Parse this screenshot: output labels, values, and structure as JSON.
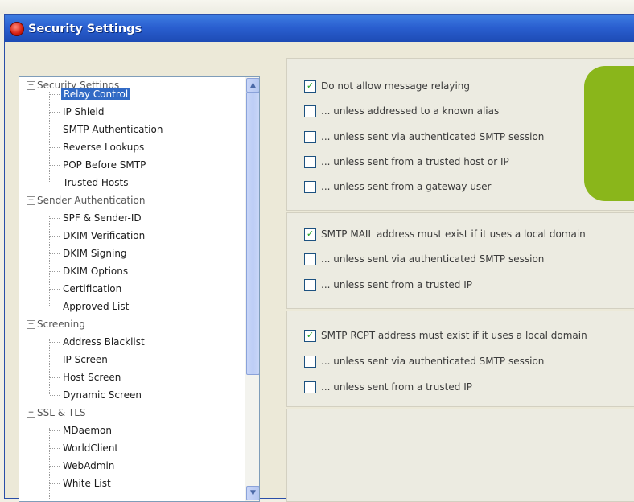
{
  "window": {
    "title": "Security Settings"
  },
  "icons": {
    "app": "app-icon",
    "expand": "expand-icon",
    "collapse": "collapse-icon",
    "scroll_up": "arrow-up-icon",
    "scroll_down": "arrow-down-icon"
  },
  "colors": {
    "titlebar": "#2a5fd0",
    "selection": "#316ac5",
    "accent_tab": "#8ab61b"
  },
  "tree": {
    "items": [
      {
        "label": "Security Settings",
        "level": 0,
        "expanded": true
      },
      {
        "label": "Relay Control",
        "level": 1,
        "selected": true
      },
      {
        "label": "IP Shield",
        "level": 1
      },
      {
        "label": "SMTP Authentication",
        "level": 1
      },
      {
        "label": "Reverse Lookups",
        "level": 1
      },
      {
        "label": "POP Before SMTP",
        "level": 1
      },
      {
        "label": "Trusted Hosts",
        "level": 1
      },
      {
        "label": "Sender Authentication",
        "level": 0,
        "expanded": true
      },
      {
        "label": "SPF & Sender-ID",
        "level": 1
      },
      {
        "label": "DKIM Verification",
        "level": 1
      },
      {
        "label": "DKIM Signing",
        "level": 1
      },
      {
        "label": "DKIM Options",
        "level": 1
      },
      {
        "label": "Certification",
        "level": 1
      },
      {
        "label": "Approved List",
        "level": 1
      },
      {
        "label": "Screening",
        "level": 0,
        "expanded": true
      },
      {
        "label": "Address Blacklist",
        "level": 1
      },
      {
        "label": "IP Screen",
        "level": 1
      },
      {
        "label": "Host Screen",
        "level": 1
      },
      {
        "label": "Dynamic Screen",
        "level": 1
      },
      {
        "label": "SSL & TLS",
        "level": 0,
        "expanded": true
      },
      {
        "label": "MDaemon",
        "level": 1
      },
      {
        "label": "WorldClient",
        "level": 1
      },
      {
        "label": "WebAdmin",
        "level": 1
      },
      {
        "label": "White List",
        "level": 1
      }
    ]
  },
  "groups": [
    {
      "options": [
        {
          "label": "Do not allow message relaying",
          "checked": true
        },
        {
          "label": "... unless addressed to a known alias",
          "checked": false
        },
        {
          "label": "... unless sent via authenticated SMTP session",
          "checked": false
        },
        {
          "label": "... unless sent from a trusted host or IP",
          "checked": false
        },
        {
          "label": "... unless sent from a gateway user",
          "checked": false
        }
      ]
    },
    {
      "options": [
        {
          "label": "SMTP MAIL address must exist if it uses a local domain",
          "checked": true
        },
        {
          "label": "... unless sent via authenticated SMTP session",
          "checked": false
        },
        {
          "label": "... unless sent from a trusted IP",
          "checked": false
        }
      ]
    },
    {
      "options": [
        {
          "label": "SMTP RCPT address must exist if it uses a local domain",
          "checked": true
        },
        {
          "label": "... unless sent via authenticated SMTP session",
          "checked": false
        },
        {
          "label": "... unless sent from a trusted IP",
          "checked": false
        }
      ]
    }
  ]
}
